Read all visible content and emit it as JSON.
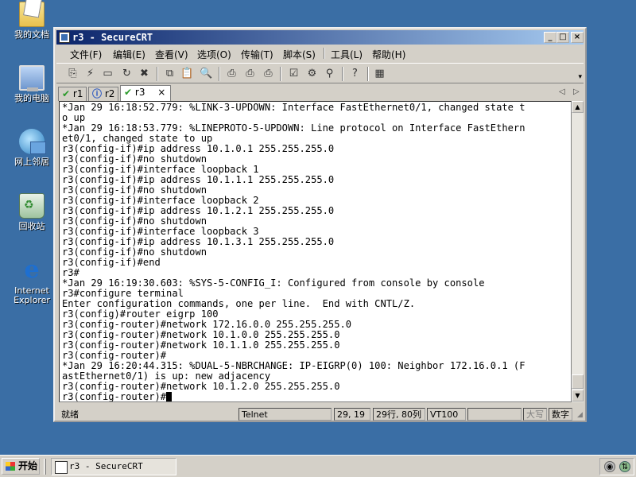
{
  "desktop": {
    "icons": [
      {
        "label": "我的文档"
      },
      {
        "label": "我的电脑"
      },
      {
        "label": "网上邻居"
      },
      {
        "label": "回收站"
      },
      {
        "label_line1": "Internet",
        "label_line2": "Explorer"
      }
    ]
  },
  "window": {
    "title": "r3 - SecureCRT",
    "controls": {
      "minimize": "_",
      "maximize": "□",
      "close": "×"
    }
  },
  "menu": [
    "文件(F)",
    "编辑(E)",
    "查看(V)",
    "选项(O)",
    "传输(T)",
    "脚本(S)",
    "工具(L)",
    "帮助(H)"
  ],
  "toolbar": {
    "icons": [
      "connect-icon",
      "quick-connect-icon",
      "connect-in-tab-icon",
      "reconnect-icon",
      "disconnect-icon",
      "copy-icon",
      "paste-icon",
      "find-icon",
      "print-icon",
      "print-selection-icon",
      "print-setup-icon",
      "session-options-icon",
      "global-options-icon",
      "keymap-icon",
      "help-icon",
      "keypad-icon"
    ]
  },
  "tabs": [
    {
      "label": "r1",
      "status": "connected"
    },
    {
      "label": "r2",
      "status": "info"
    },
    {
      "label": "r3",
      "status": "connected",
      "active": true,
      "close": "×"
    }
  ],
  "terminal": {
    "lines": [
      "*Jan 29 16:18:52.779: %LINK-3-UPDOWN: Interface FastEthernet0/1, changed state t",
      "o up",
      "*Jan 29 16:18:53.779: %LINEPROTO-5-UPDOWN: Line protocol on Interface FastEthern",
      "et0/1, changed state to up",
      "r3(config-if)#ip address 10.1.0.1 255.255.255.0",
      "r3(config-if)#no shutdown",
      "r3(config-if)#interface loopback 1",
      "r3(config-if)#ip address 10.1.1.1 255.255.255.0",
      "r3(config-if)#no shutdown",
      "r3(config-if)#interface loopback 2",
      "r3(config-if)#ip address 10.1.2.1 255.255.255.0",
      "r3(config-if)#no shutdown",
      "r3(config-if)#interface loopback 3",
      "r3(config-if)#ip address 10.1.3.1 255.255.255.0",
      "r3(config-if)#no shutdown",
      "r3(config-if)#end",
      "r3#",
      "*Jan 29 16:19:30.603: %SYS-5-CONFIG_I: Configured from console by console",
      "r3#configure terminal",
      "Enter configuration commands, one per line.  End with CNTL/Z.",
      "r3(config)#router eigrp 100",
      "r3(config-router)#network 172.16.0.0 255.255.255.0",
      "r3(config-router)#network 10.1.0.0 255.255.255.0",
      "r3(config-router)#network 10.1.1.0 255.255.255.0",
      "r3(config-router)#",
      "*Jan 29 16:20:44.315: %DUAL-5-NBRCHANGE: IP-EIGRP(0) 100: Neighbor 172.16.0.1 (F",
      "astEthernet0/1) is up: new adjacency",
      "r3(config-router)#network 10.1.2.0 255.255.255.0"
    ],
    "prompt": "r3(config-router)#"
  },
  "statusbar": {
    "ready": "就绪",
    "protocol": "Telnet",
    "position": "29, 19",
    "size": "29行, 80列",
    "emulation": "VT100",
    "caps": "大写",
    "num": "数字"
  },
  "taskbar": {
    "start": "开始",
    "task": "r3 - SecureCRT"
  }
}
